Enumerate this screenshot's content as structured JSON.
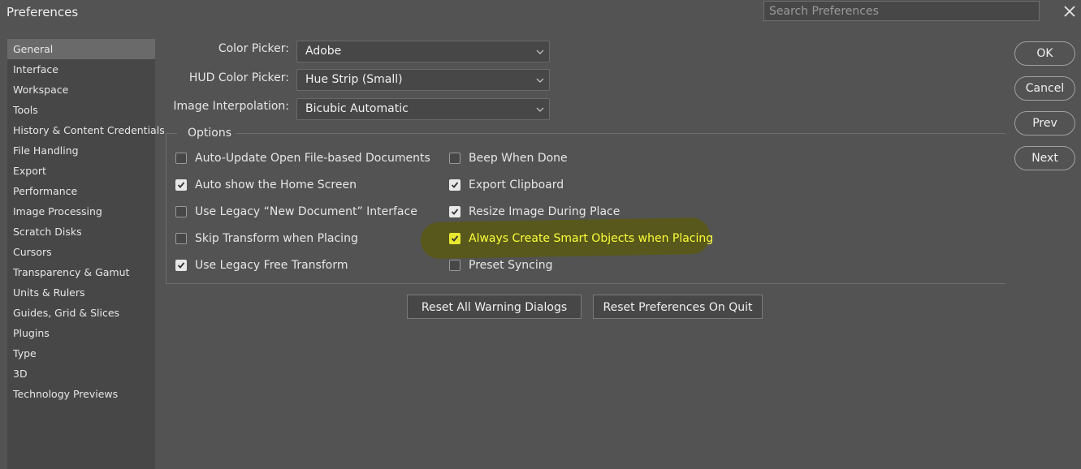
{
  "window": {
    "title": "Preferences"
  },
  "search": {
    "placeholder": "Search Preferences"
  },
  "sidebar": {
    "items": [
      {
        "label": "General"
      },
      {
        "label": "Interface"
      },
      {
        "label": "Workspace"
      },
      {
        "label": "Tools"
      },
      {
        "label": "History & Content Credentials"
      },
      {
        "label": "File Handling"
      },
      {
        "label": "Export"
      },
      {
        "label": "Performance"
      },
      {
        "label": "Image Processing"
      },
      {
        "label": "Scratch Disks"
      },
      {
        "label": "Cursors"
      },
      {
        "label": "Transparency & Gamut"
      },
      {
        "label": "Units & Rulers"
      },
      {
        "label": "Guides, Grid & Slices"
      },
      {
        "label": "Plugins"
      },
      {
        "label": "Type"
      },
      {
        "label": "3D"
      },
      {
        "label": "Technology Previews"
      }
    ],
    "active": "General"
  },
  "fields": [
    {
      "label": "Color Picker:",
      "value": "Adobe"
    },
    {
      "label": "HUD Color Picker:",
      "value": "Hue Strip (Small)"
    },
    {
      "label": "Image Interpolation:",
      "value": "Bicubic Automatic"
    }
  ],
  "options": {
    "title": "Options",
    "left": [
      {
        "label": "Auto-Update Open File-based Documents",
        "checked": false
      },
      {
        "label": "Auto show the Home Screen",
        "checked": true
      },
      {
        "label": "Use Legacy “New Document” Interface",
        "checked": false
      },
      {
        "label": "Skip Transform when Placing",
        "checked": false
      },
      {
        "label": "Use Legacy Free Transform",
        "checked": true
      }
    ],
    "right": [
      {
        "label": "Beep When Done",
        "checked": false
      },
      {
        "label": "Export Clipboard",
        "checked": true
      },
      {
        "label": "Resize Image During Place",
        "checked": true
      },
      {
        "label": "Always Create Smart Objects when Placing",
        "checked": true,
        "highlighted": true
      },
      {
        "label": "Preset Syncing",
        "checked": false
      }
    ]
  },
  "reset_buttons": {
    "warnings": "Reset All Warning Dialogs",
    "preferences": "Reset Preferences On Quit"
  },
  "dialog_buttons": {
    "ok": "OK",
    "cancel": "Cancel",
    "prev": "Prev",
    "next": "Next"
  },
  "colors": {
    "background": "#535353",
    "panel": "#474747",
    "highlight_text": "#ffff3a",
    "highlight_mark": "#58581c"
  }
}
